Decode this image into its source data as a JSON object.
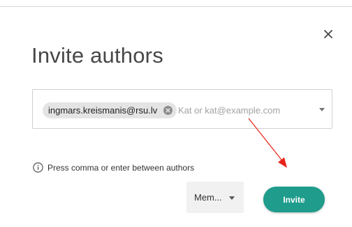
{
  "dialog": {
    "title": "Invite authors",
    "close_icon": "close-icon"
  },
  "authors_field": {
    "chips": [
      {
        "email": "ingmars.kreismanis@rsu.lv",
        "remove_icon": "cancel-circle-icon"
      }
    ],
    "input_value": "",
    "placeholder": "Kat or kat@example.com",
    "dropdown_icon": "caret-down-icon"
  },
  "hint": {
    "icon": "info-icon",
    "text": "Press comma or enter between authors"
  },
  "role_select": {
    "selected": "Mem...",
    "icon": "caret-down-icon"
  },
  "invite_button": {
    "label": "Invite"
  },
  "colors": {
    "accent": "#1f9c8c",
    "annotation_arrow": "#e8231a",
    "chip_bg": "#e4e4e4",
    "role_bg": "#f1f1f1"
  }
}
